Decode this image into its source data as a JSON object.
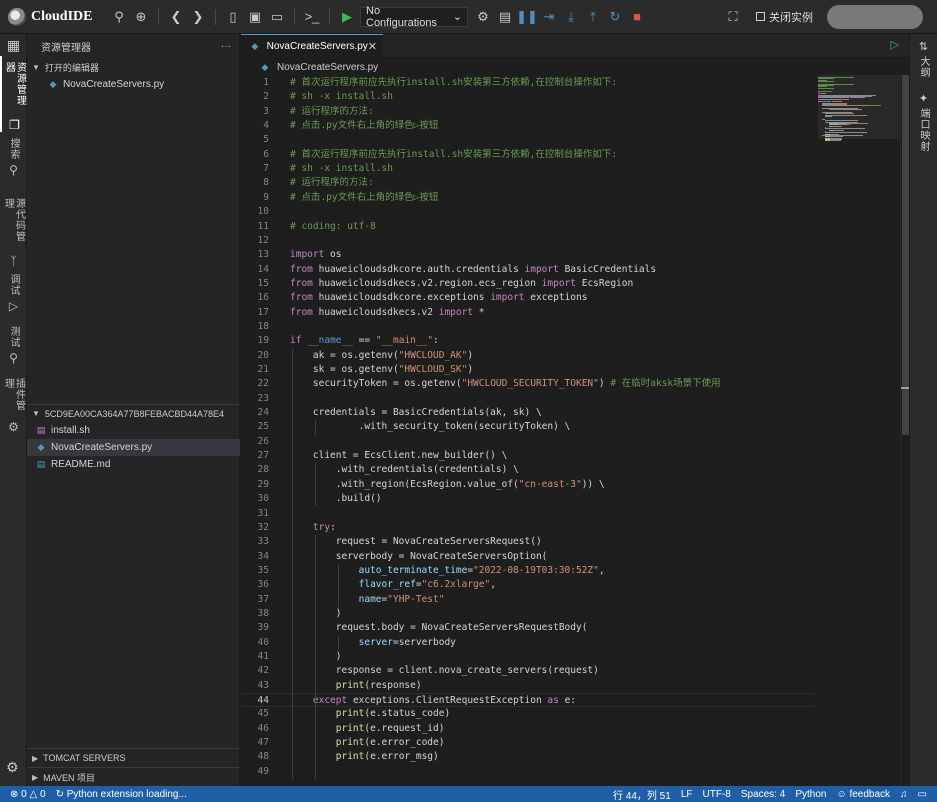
{
  "app": {
    "name": "CloudIDE",
    "run_config": "No Configurations",
    "close_instance": "关闭实例"
  },
  "activity_bar": {
    "items": [
      {
        "label": "资源管理器",
        "icon": "files-icon"
      },
      {
        "label": "搜索",
        "icon": "search-icon"
      },
      {
        "label": "源代码管理",
        "icon": "source-control-icon"
      },
      {
        "label": "调试",
        "icon": "debug-icon"
      },
      {
        "label": "测试",
        "icon": "test-flask-icon"
      },
      {
        "label": "插件管理",
        "icon": "extensions-icon"
      }
    ]
  },
  "sidebar": {
    "title": "资源管理器",
    "more": "···",
    "open_editors": {
      "label": "打开的编辑器",
      "files": [
        "NovaCreateServers.py"
      ]
    },
    "workspace": {
      "label": "5CD9EA00CA364A77B8FEBACBD44A78E4",
      "files": [
        {
          "name": "install.sh",
          "type": "sh"
        },
        {
          "name": "NovaCreateServers.py",
          "type": "py"
        },
        {
          "name": "README.md",
          "type": "md"
        }
      ]
    },
    "bottom_sections": [
      "TOMCAT SERVERS",
      "MAVEN 项目"
    ]
  },
  "editor": {
    "tab_label": "NovaCreateServers.py",
    "breadcrumb": "NovaCreateServers.py",
    "current_line": 44,
    "lines": [
      [
        [
          "cm",
          "# 首次运行程序前应先执行install.sh安装第三方依赖,在控制台操作如下:"
        ]
      ],
      [
        [
          "cm",
          "# sh -x install.sh"
        ]
      ],
      [
        [
          "cm",
          "# 运行程序的方法:"
        ]
      ],
      [
        [
          "cm",
          "# 点击.py文件右上角的绿色▷按钮"
        ]
      ],
      [],
      [
        [
          "cm",
          "# 首次运行程序前应先执行install.sh安装第三方依赖,在控制台操作如下:"
        ]
      ],
      [
        [
          "cm",
          "# sh -x install.sh"
        ]
      ],
      [
        [
          "cm",
          "# 运行程序的方法:"
        ]
      ],
      [
        [
          "cm",
          "# 点击.py文件右上角的绿色▷按钮"
        ]
      ],
      [],
      [
        [
          "cm",
          "# coding: utf-8"
        ]
      ],
      [],
      [
        [
          "kw",
          "import"
        ],
        [
          "id",
          " os"
        ]
      ],
      [
        [
          "kw",
          "from"
        ],
        [
          "id",
          " huaweicloudsdkcore.auth.credentials "
        ],
        [
          "kw",
          "import"
        ],
        [
          "id",
          " BasicCredentials"
        ]
      ],
      [
        [
          "kw",
          "from"
        ],
        [
          "id",
          " huaweicloudsdkecs.v2.region.ecs_region "
        ],
        [
          "kw",
          "import"
        ],
        [
          "id",
          " EcsRegion"
        ]
      ],
      [
        [
          "kw",
          "from"
        ],
        [
          "id",
          " huaweicloudsdkcore.exceptions "
        ],
        [
          "kw",
          "import"
        ],
        [
          "id",
          " exceptions"
        ]
      ],
      [
        [
          "kw",
          "from"
        ],
        [
          "id",
          " huaweicloudsdkecs.v2 "
        ],
        [
          "kw",
          "import"
        ],
        [
          "id",
          " *"
        ]
      ],
      [],
      [
        [
          "kw",
          "if"
        ],
        [
          "id",
          " "
        ],
        [
          "bl",
          "__name__"
        ],
        [
          "id",
          " == "
        ],
        [
          "st",
          "\"__main__\""
        ],
        [
          "id",
          ":"
        ]
      ],
      [
        [
          "id",
          "    ak = os.getenv("
        ],
        [
          "st",
          "\"HWCLOUD_AK\""
        ],
        [
          "id",
          ")"
        ]
      ],
      [
        [
          "id",
          "    sk = os.getenv("
        ],
        [
          "st",
          "\"HWCLOUD_SK\""
        ],
        [
          "id",
          ")"
        ]
      ],
      [
        [
          "id",
          "    securityToken = os.getenv("
        ],
        [
          "st",
          "\"HWCLOUD_SECURITY_TOKEN\""
        ],
        [
          "id",
          ") "
        ],
        [
          "cm",
          "# 在临时aksk场景下使用"
        ]
      ],
      [],
      [
        [
          "id",
          "    credentials = BasicCredentials(ak, sk) \\"
        ]
      ],
      [
        [
          "id",
          "            .with_security_token(securityToken) \\"
        ]
      ],
      [],
      [
        [
          "id",
          "    client = EcsClient.new_builder() \\"
        ]
      ],
      [
        [
          "id",
          "        .with_credentials(credentials) \\"
        ]
      ],
      [
        [
          "id",
          "        .with_region(EcsRegion.value_of("
        ],
        [
          "st",
          "\"cn-east-3\""
        ],
        [
          "id",
          ")) \\"
        ]
      ],
      [
        [
          "id",
          "        .build()"
        ]
      ],
      [],
      [
        [
          "id",
          "    "
        ],
        [
          "kw",
          "try"
        ],
        [
          "id",
          ":"
        ]
      ],
      [
        [
          "id",
          "        request = NovaCreateServersRequest()"
        ]
      ],
      [
        [
          "id",
          "        serverbody = NovaCreateServersOption("
        ]
      ],
      [
        [
          "id",
          "            "
        ],
        [
          "pa",
          "auto_terminate_time"
        ],
        [
          "id",
          "="
        ],
        [
          "st",
          "\"2022-08-19T03:30:52Z\""
        ],
        [
          "id",
          ","
        ]
      ],
      [
        [
          "id",
          "            "
        ],
        [
          "pa",
          "flavor_ref"
        ],
        [
          "id",
          "="
        ],
        [
          "st",
          "\"c6.2xlarge\""
        ],
        [
          "id",
          ","
        ]
      ],
      [
        [
          "id",
          "            "
        ],
        [
          "pa",
          "name"
        ],
        [
          "id",
          "="
        ],
        [
          "st",
          "\"YHP-Test\""
        ]
      ],
      [
        [
          "id",
          "        )"
        ]
      ],
      [
        [
          "id",
          "        request.body = NovaCreateServersRequestBody("
        ]
      ],
      [
        [
          "id",
          "            "
        ],
        [
          "pa",
          "server"
        ],
        [
          "id",
          "=serverbody"
        ]
      ],
      [
        [
          "id",
          "        )"
        ]
      ],
      [
        [
          "id",
          "        response = client.nova_create_servers(request)"
        ]
      ],
      [
        [
          "id",
          "        "
        ],
        [
          "fn",
          "print"
        ],
        [
          "id",
          "(response)"
        ]
      ],
      [
        [
          "id",
          "    "
        ],
        [
          "kw",
          "except"
        ],
        [
          "id",
          " exceptions.ClientRequestException "
        ],
        [
          "kw",
          "as"
        ],
        [
          "id",
          " e:"
        ]
      ],
      [
        [
          "id",
          "        "
        ],
        [
          "fn",
          "print"
        ],
        [
          "id",
          "(e.status_code)"
        ]
      ],
      [
        [
          "id",
          "        "
        ],
        [
          "fn",
          "print"
        ],
        [
          "id",
          "(e.request_id)"
        ]
      ],
      [
        [
          "id",
          "        "
        ],
        [
          "fn",
          "print"
        ],
        [
          "id",
          "(e.error_code)"
        ]
      ],
      [
        [
          "id",
          "        "
        ],
        [
          "fn",
          "print"
        ],
        [
          "id",
          "(e.error_msg)"
        ]
      ],
      []
    ]
  },
  "right_panel": {
    "items": [
      {
        "label": "大纲",
        "icon": "outline-icon"
      },
      {
        "label": "端口映射",
        "icon": "port-mapping-icon"
      }
    ]
  },
  "status_bar": {
    "problems": "0",
    "warnings": "0",
    "loading": "Python extension loading...",
    "position": "行 44，列 51",
    "eol": "LF",
    "encoding": "UTF-8",
    "indent": "Spaces: 4",
    "language": "Python",
    "feedback": "feedback"
  },
  "colors": {
    "accent": "#1f5fa8",
    "comment": "#6a9955",
    "keyword": "#c586c0",
    "string": "#ce9178",
    "run": "#3fb950"
  }
}
